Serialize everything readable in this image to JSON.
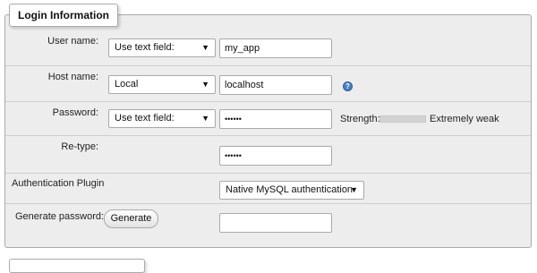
{
  "section": {
    "legend": "Login Information"
  },
  "fields": {
    "username": {
      "label": "User name:",
      "mode": "Use text field:",
      "value": "my_app"
    },
    "hostname": {
      "label": "Host name:",
      "mode": "Local",
      "value": "localhost",
      "help_icon": "help-icon"
    },
    "password": {
      "label": "Password:",
      "mode": "Use text field:",
      "value": "••••••",
      "strength_label": "Strength:",
      "strength_text": "Extremely weak",
      "strength_level": 0
    },
    "retype": {
      "label": "Re-type:",
      "value": "••••••"
    },
    "auth_plugin": {
      "label": "Authentication Plugin",
      "value": "Native MySQL authentication"
    },
    "generate": {
      "label": "Generate password:",
      "button_label": "Generate",
      "value": ""
    }
  },
  "icons": {
    "dropdown": "▼",
    "help": "?"
  },
  "colors": {
    "panel_bg": "#ededed",
    "help_icon": "#4a7fc1"
  }
}
